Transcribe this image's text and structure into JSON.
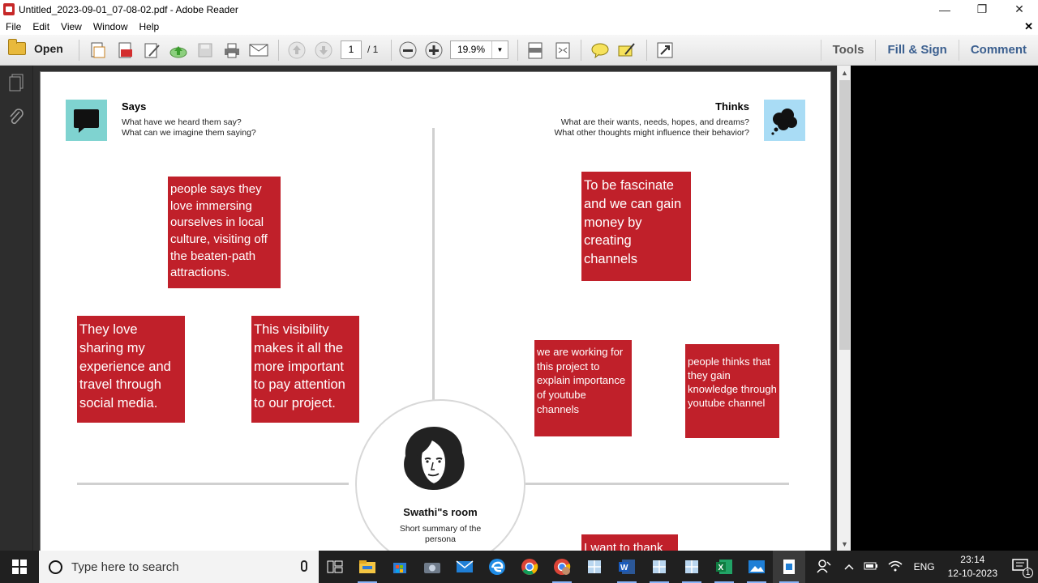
{
  "window": {
    "title": "Untitled_2023-09-01_07-08-02.pdf - Adobe Reader",
    "minimize": "—",
    "restore": "❐",
    "close": "✕"
  },
  "menu": [
    "File",
    "Edit",
    "View",
    "Window",
    "Help"
  ],
  "toolbar": {
    "open_label": "Open",
    "page_current": "1",
    "page_total": "/ 1",
    "zoom": "19.9%",
    "tools_label": "Tools",
    "fill_sign_label": "Fill & Sign",
    "comment_label": "Comment"
  },
  "empathy_map": {
    "says": {
      "title": "Says",
      "subtitle_1": "What have we heard them say?",
      "subtitle_2": "What can we imagine them saying?"
    },
    "thinks": {
      "title": "Thinks",
      "subtitle_1": "What are their wants, needs, hopes, and dreams?",
      "subtitle_2": "What other thoughts might influence their behavior?"
    },
    "persona": {
      "name": "Swathi\"s room",
      "summary": "Short summary of the persona"
    },
    "notes": [
      "people says they love immersing ourselves in local culture, visiting off the beaten-path attractions.",
      "They love sharing my experience and travel through social media.",
      "This visibility makes it all the more important to pay attention to our project.",
      "To be fascinate and we can gain money by creating channels",
      "we are working for this project to explain importance of youtube channels",
      "people thinks that they gain knowledge through youtube channel",
      "I want to thank"
    ]
  },
  "taskbar": {
    "search_placeholder": "Type here to search",
    "language": "ENG",
    "time": "23:14",
    "date": "12-10-2023",
    "notification_count": "1"
  },
  "colors": {
    "note_red": "#c0202a",
    "says_icon_bg": "#7fd3d0",
    "thinks_icon_bg": "#a9dcf5"
  }
}
